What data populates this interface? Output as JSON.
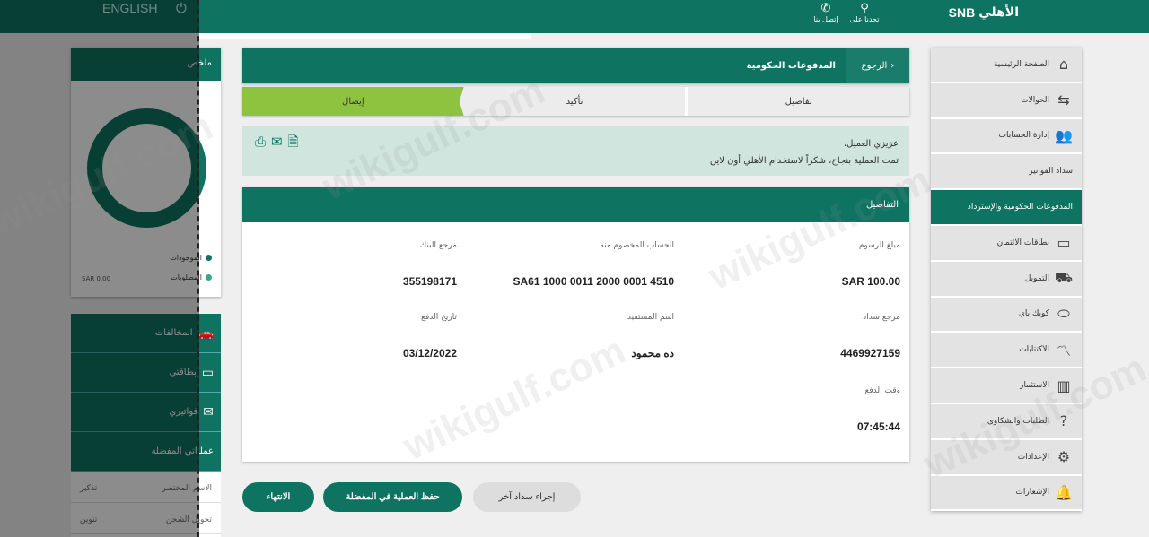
{
  "topbar": {
    "brand_ar": "الأهلي",
    "brand_en": "SNB",
    "find_us": "تجدنا على",
    "contact": "إتصل بنا",
    "language": "ENGLISH",
    "icons": [
      "location-pin-icon",
      "phone-icon",
      "power-icon"
    ]
  },
  "sidebar": {
    "items": [
      {
        "label": "الصفحة الرئيسية",
        "icon": "⌂"
      },
      {
        "label": "الحوالات",
        "icon": "⇆"
      },
      {
        "label": "إدارة الحسابات",
        "icon": "👥"
      },
      {
        "label": "سداد الفواتير",
        "icon": ""
      },
      {
        "label": "المدفوعات الحكومية والإسترداد",
        "icon": "",
        "active": true
      },
      {
        "label": "بطاقات الائتمان",
        "icon": "▭"
      },
      {
        "label": "التمويل",
        "icon": "⛟"
      },
      {
        "label": "كويك باي",
        "icon": "⬭"
      },
      {
        "label": "الاكتتابات",
        "icon": "〽"
      },
      {
        "label": "الاستثمار",
        "icon": "▥"
      },
      {
        "label": "الطلبات والشكاوى",
        "icon": "?"
      },
      {
        "label": "الإعدادات",
        "icon": "⚙"
      },
      {
        "label": "الإشعارات",
        "icon": "🔔"
      }
    ]
  },
  "header": {
    "back": "الرجوع",
    "title": "المدفوعات الحكومية"
  },
  "steps": [
    "تفاصيل",
    "تأكيد",
    "إيصال"
  ],
  "message": {
    "greeting": "عزيزي العميل،",
    "text": "تمت العملية بنجاح، شكراً لاستخدام الأهلي أون لاين"
  },
  "details": {
    "title": "التفاصيل",
    "fields": [
      {
        "label": "مبلغ الرسوم",
        "value": "SAR 100.00"
      },
      {
        "label": "الحساب المخصوم منه",
        "value": "SA61 1000 0011 2000 0001 4510"
      },
      {
        "label": "مرجع البنك",
        "value": "355198171"
      },
      {
        "label": "مرجع سداد",
        "value": "4469927159"
      },
      {
        "label": "اسم المستفيد",
        "value": "ده محمود"
      },
      {
        "label": "تاريخ الدفع",
        "value": "03/12/2022"
      },
      {
        "label": "وقت الدفع",
        "value": "07:45:44"
      }
    ]
  },
  "buttons": {
    "another": "إجراء سداد آخر",
    "save": "حفظ العملية في المفضلة",
    "finish": "الانتهاء"
  },
  "summary": {
    "title": "ملخص",
    "assets": "الموجودات",
    "liabilities": "المطلوبات",
    "amount": "SAR 0.00",
    "colors": {
      "assets": "#0e7361",
      "liabilities": "#3aa58a"
    }
  },
  "quick": {
    "items": [
      {
        "label": "المخالفات",
        "icon": "🚗"
      },
      {
        "label": "بطاقتي",
        "icon": "▭"
      },
      {
        "label": "فواتيري",
        "icon": "✉"
      },
      {
        "label": "عملياتي المفضلة",
        "icon": ""
      }
    ],
    "rows": [
      {
        "a": "الاسم المختصر",
        "b": "تذكير"
      },
      {
        "a": "تحويل الشحن",
        "b": "تنوين"
      }
    ]
  },
  "watermark": "wikigulf.com",
  "colors": {
    "primary": "#0e7361",
    "step_active": "#8dc33f",
    "message_bg": "#cfe5dd"
  }
}
